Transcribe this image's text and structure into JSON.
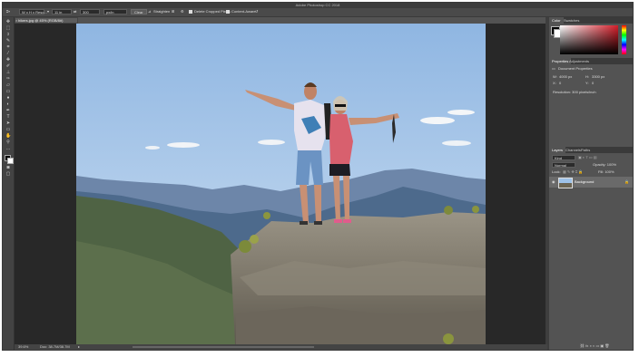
{
  "app": {
    "title": "Adobe Photoshop CC 2018"
  },
  "options_bar": {
    "ratio": "W x H x Reso...",
    "width": "11 in",
    "height": "300",
    "unit": "px/in",
    "clear": "Clear",
    "straighten": "Straighten",
    "delete_cropped": "Delete Cropped Pixels",
    "content_aware": "Content-Aware"
  },
  "document": {
    "tab": "hikers.jpg @ 45% (RGB/8#)",
    "zoom": "39.6%",
    "doc_size": "Doc: 38.7M/38.7M"
  },
  "panels": {
    "color_tab": "Color",
    "swatches_tab": "Swatches",
    "properties_tab": "Properties",
    "adjustments_tab": "Adjustments",
    "properties_title": "Document Properties",
    "w_label": "W:",
    "w_value": "4000 px",
    "h_label": "H:",
    "h_value": "3300 px",
    "x_label": "X:",
    "x_value": "0",
    "y_label": "Y:",
    "y_value": "0",
    "resolution": "Resolution: 300 pixels/inch",
    "layers_tab": "Layers",
    "channels_tab": "Channels",
    "paths_tab": "Paths",
    "kind": "Kind",
    "normal": "Normal",
    "opacity": "Opacity: 100%",
    "lock": "Lock:",
    "fill": "Fill: 100%",
    "layer_name": "Background"
  },
  "colors": {
    "accent": "#2b2b2b",
    "panel": "#535353",
    "sky": "#9ec2e8"
  }
}
